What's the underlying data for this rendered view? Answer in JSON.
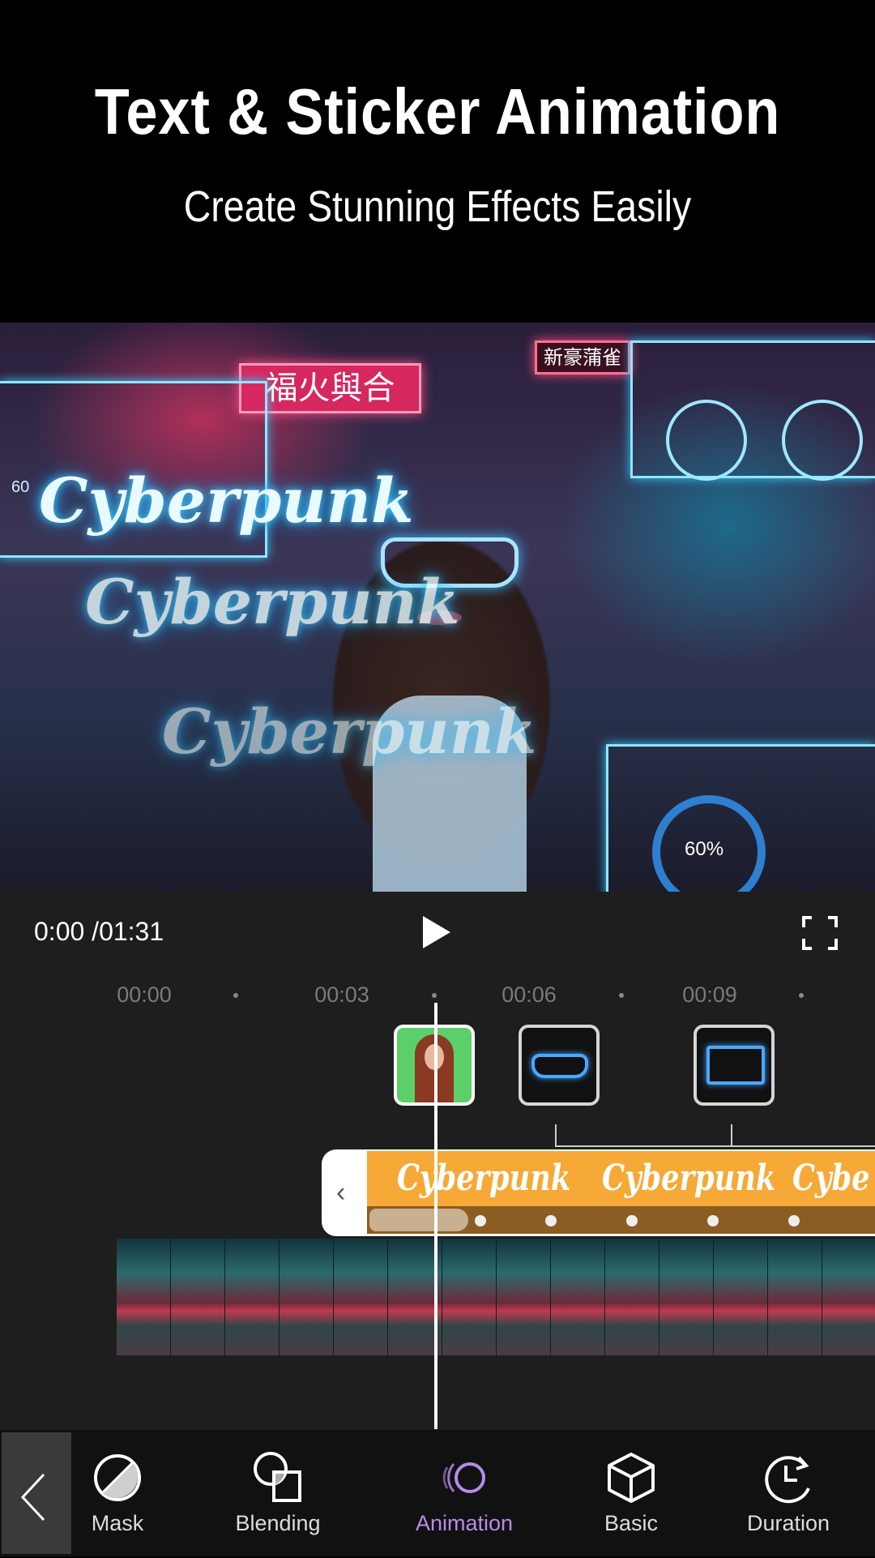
{
  "header": {
    "title": "Text & Sticker Animation",
    "subtitle": "Create Stunning Effects Easily"
  },
  "preview": {
    "overlay_texts": [
      "Cyberpunk",
      "Cyberpunk",
      "Cyberpunk"
    ],
    "hud_left_value": "60",
    "hud_percent": "60%",
    "signs": [
      "新豪蒲雀",
      "福火與合"
    ]
  },
  "player": {
    "time": "0:00 /01:31",
    "play_icon": "play-icon",
    "fullscreen_icon": "fullscreen-icon"
  },
  "ruler": {
    "labels": [
      "00:00",
      "00:03",
      "00:06",
      "00:09"
    ]
  },
  "text_track": {
    "label": "Cyberpunk",
    "repeats": [
      "Cyberpunk",
      "Cyberpunk",
      "Cybe"
    ],
    "color": "#f6a937"
  },
  "toolbar": {
    "items": [
      {
        "label": "Mask",
        "icon": "mask-icon"
      },
      {
        "label": "Blending",
        "icon": "blending-icon"
      },
      {
        "label": "Animation",
        "icon": "animation-icon",
        "active": true
      },
      {
        "label": "Basic",
        "icon": "cube-icon"
      },
      {
        "label": "Duration",
        "icon": "clock-icon"
      }
    ],
    "accent": "#b88be8"
  }
}
